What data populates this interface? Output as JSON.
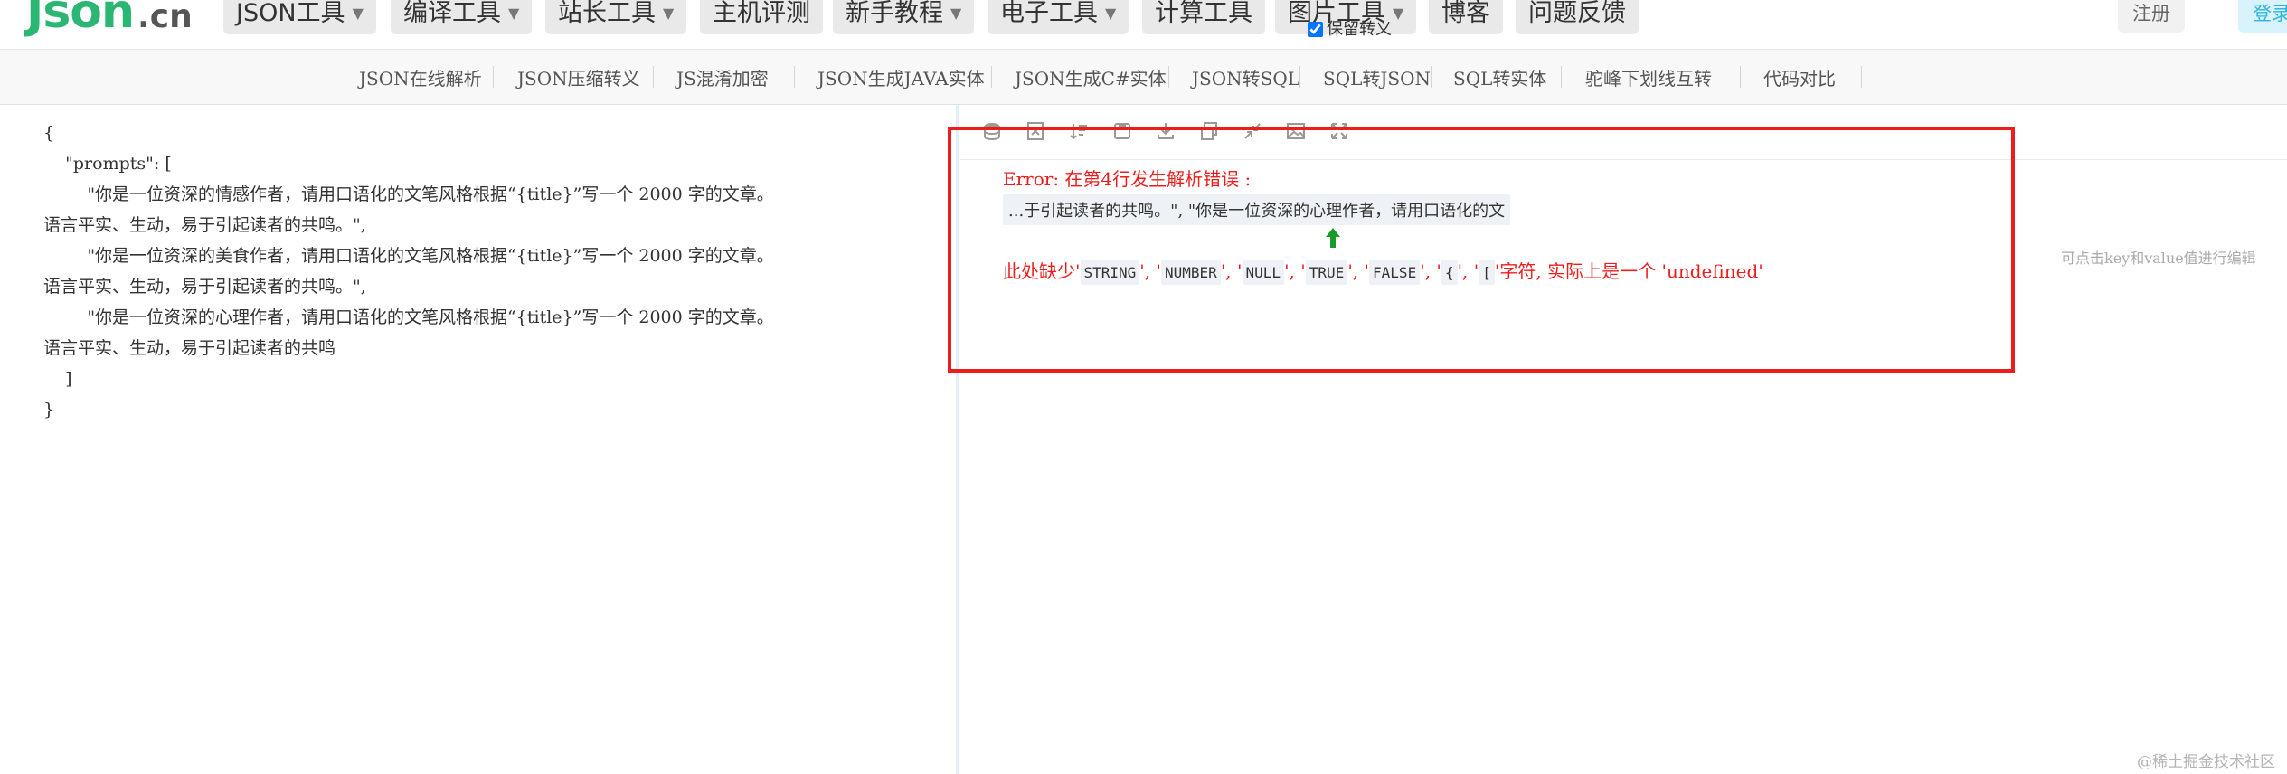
{
  "logo": {
    "main": "Json",
    "suffix": ".cn"
  },
  "nav": [
    {
      "label": "JSON工具",
      "dropdown": true
    },
    {
      "label": "编译工具",
      "dropdown": true
    },
    {
      "label": "站长工具",
      "dropdown": true
    },
    {
      "label": "主机评测",
      "dropdown": false
    },
    {
      "label": "新手教程",
      "dropdown": true
    },
    {
      "label": "电子工具",
      "dropdown": true
    },
    {
      "label": "计算工具",
      "dropdown": false
    },
    {
      "label": "图片工具",
      "dropdown": true
    },
    {
      "label": "博客",
      "dropdown": false
    },
    {
      "label": "问题反馈",
      "dropdown": false
    }
  ],
  "auth": {
    "register": "注册",
    "login": "登录"
  },
  "subnav": [
    "JSON在线解析",
    "JSON压缩转义",
    "JS混淆加密",
    "JSON生成JAVA实体",
    "JSON生成C#实体",
    "JSON转SQL",
    "SQL转JSON",
    "SQL转实体",
    "驼峰下划线互转",
    "代码对比"
  ],
  "editor": {
    "lines": [
      "{",
      "    \"prompts\": [",
      "        \"你是一位资深的情感作者，请用口语化的文笔风格根据“{title}”写一个 2000 字的文章。",
      "语言平实、生动，易于引起读者的共鸣。\",",
      "        \"你是一位资深的美食作者，请用口语化的文笔风格根据“{title}”写一个 2000 字的文章。",
      "语言平实、生动，易于引起读者的共鸣。\",",
      "        \"你是一位资深的心理作者，请用口语化的文笔风格根据“{title}”写一个 2000 字的文章。",
      "语言平实、生动，易于引起读者的共鸣",
      "    ]",
      "}"
    ]
  },
  "toolbar": {
    "icons": [
      "database-icon",
      "excel-icon",
      "sort-icon",
      "save-icon",
      "download-icon",
      "copy-icon",
      "compress-icon",
      "image-icon",
      "expand-icon"
    ],
    "keep_escape_label": "保留转义",
    "keep_escape_checked": true
  },
  "error": {
    "title": "Error: 在第4行发生解析错误 :",
    "snippet": "...于引起读者的共鸣。\", \"你是一位资深的心理作者，请用口语化的文",
    "detail_prefix": "此处缺少'",
    "expected": [
      "STRING",
      "NUMBER",
      "NULL",
      "TRUE",
      "FALSE",
      "{",
      "["
    ],
    "detail_suffix": "'字符, 实际上是一个 'undefined'"
  },
  "hint": "可点击key和value值进行编辑",
  "watermark": "@稀土掘金技术社区",
  "colors": {
    "logo": "#2bb673",
    "error": "#ee1d1d",
    "arrow": "#1a9a2a",
    "login": "#2fb6e0"
  }
}
